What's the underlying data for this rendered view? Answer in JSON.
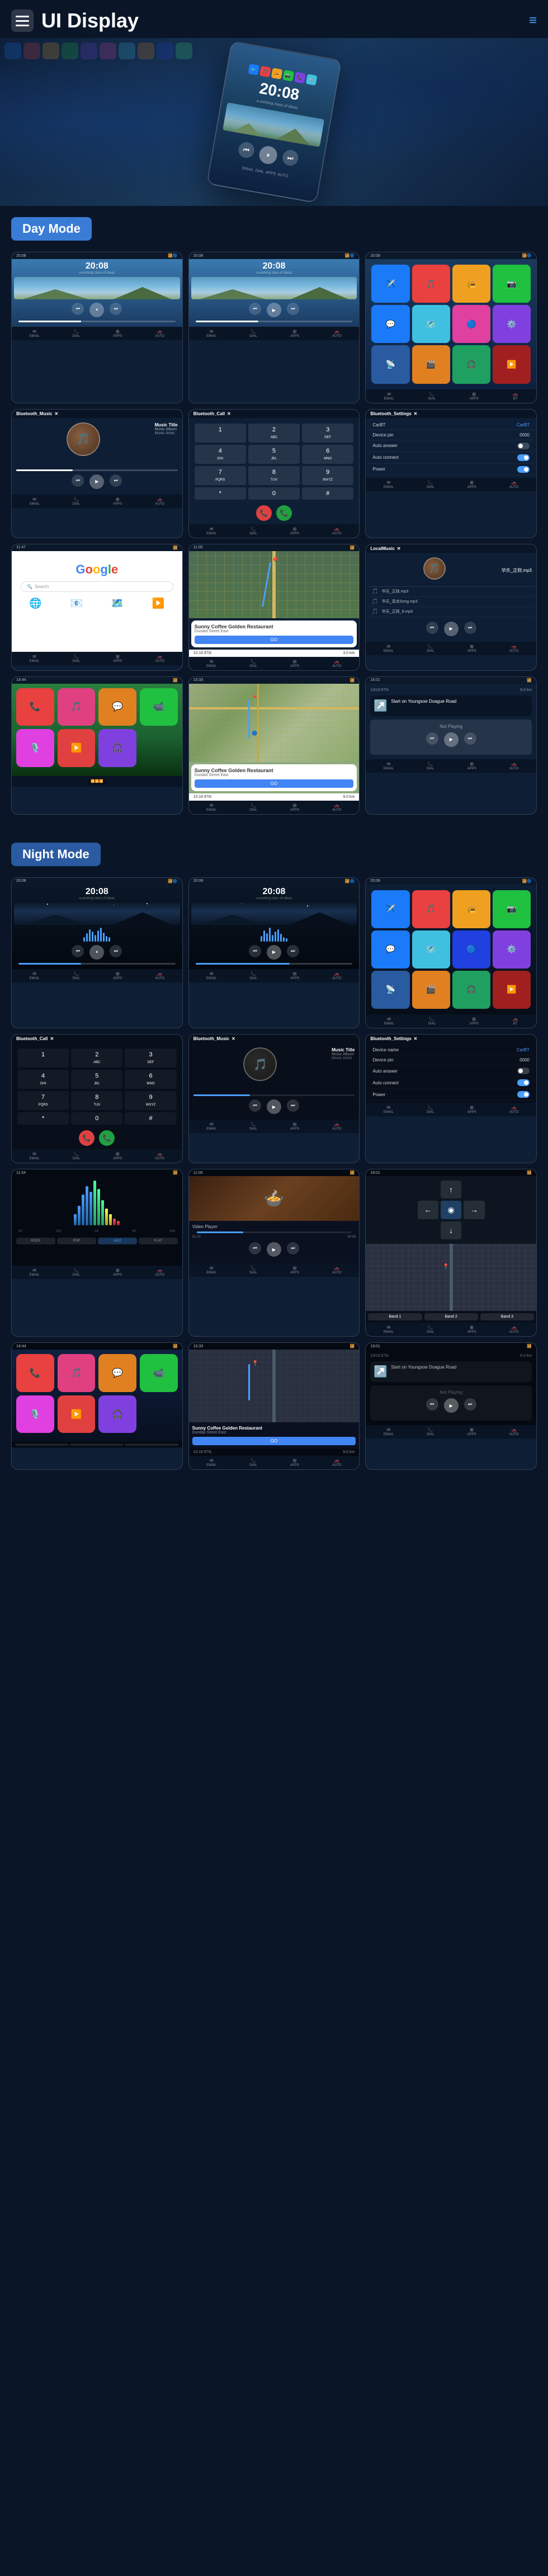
{
  "header": {
    "title": "UI Display",
    "menu_icon": "≡",
    "nav_icon": "≡"
  },
  "day_mode": {
    "label": "Day Mode"
  },
  "night_mode": {
    "label": "Night Mode"
  },
  "screens": {
    "time": "20:08",
    "time_subtitle": "a working class of ideas",
    "music_title": "Music Title",
    "music_album": "Music Album",
    "music_artist": "Music Artist",
    "bluetooth_music": "Bluetooth_Music",
    "bluetooth_call": "Bluetooth_Call",
    "bluetooth_settings": "Bluetooth_Settings",
    "device_name": "CarBT",
    "device_pin": "0000",
    "auto_answer": "Auto answer",
    "auto_connect": "Auto connect",
    "power": "Power",
    "google": "Google",
    "local_music": "LocalMusic",
    "songs": [
      "华乐_正则.mp3",
      "华乐_双龙Song.mp3",
      "华乐_正则_8.mp3"
    ],
    "nav_destination": "Sunny Coffee Golden Restaurant",
    "nav_address": "Dundas Street East",
    "nav_eta": "10:16 ETA",
    "nav_distance": "9.0 km",
    "nav_go": "GO",
    "not_playing": "Not Playing",
    "start_on": "Start on Youngsoe Doague Road"
  },
  "icons": {
    "phone": "📞",
    "music": "🎵",
    "maps": "🗺️",
    "settings": "⚙️",
    "wifi": "📶",
    "bluetooth": "🔵",
    "apps": "⊞",
    "back": "◀",
    "play": "▶",
    "pause": "⏸",
    "prev": "⏮",
    "next": "⏭",
    "search": "🔍"
  }
}
